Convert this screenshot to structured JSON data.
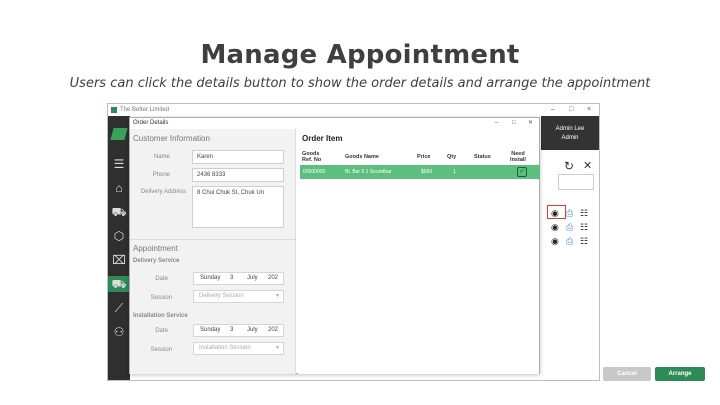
{
  "slide": {
    "title": "Manage Appointment",
    "subtitle": "Users can click the details button to show the order details and arrange the appointment"
  },
  "app": {
    "window_title": "The Better Limited",
    "user_name": "Admin Lee",
    "user_role": "Admin",
    "win_min": "–",
    "win_max": "□",
    "win_close": "×"
  },
  "dialog": {
    "title": "Order Details",
    "controls": {
      "min": "–",
      "max": "□",
      "close": "✕"
    },
    "customer": {
      "heading": "Customer Information",
      "name_label": "Name",
      "name_value": "Karen",
      "phone_label": "Phone",
      "phone_value": "2436 8333",
      "address_label": "Delivery Address",
      "address_value": "8 Chui Chuk St, Chuk Un"
    },
    "appointment": {
      "heading": "Appointment",
      "delivery_heading": "Delivery Service",
      "delivery_date_label": "Date",
      "delivery_date": {
        "weekday": "Sunday",
        "day": "3",
        "month": "July",
        "year": "202"
      },
      "delivery_session_label": "Session",
      "delivery_session_placeholder": "Delivery Session",
      "install_heading": "Installation Service",
      "install_date_label": "Date",
      "install_date": {
        "weekday": "Sunday",
        "day": "3",
        "month": "July",
        "year": "202"
      },
      "install_session_label": "Session",
      "install_session_placeholder": "Installation Session"
    },
    "order": {
      "heading": "Order Item",
      "columns": [
        "Goods Ref. No",
        "Goods Name",
        "Price",
        "Qty",
        "Status",
        "Need Install"
      ],
      "rows": [
        {
          "ref": "00000000",
          "name": "BL Bar 5.1 Soundbar",
          "price": "$560",
          "qty": "1",
          "status": "",
          "need_install": true
        }
      ]
    },
    "buttons": {
      "cancel": "Cancel",
      "arrange": "Arrange"
    }
  },
  "icons": {
    "sidebar": [
      "menu-icon",
      "home-icon",
      "cart-icon",
      "box-icon",
      "bag-icon",
      "truck-icon",
      "chart-icon",
      "users-icon"
    ],
    "row_actions": [
      "eye-icon",
      "printer-icon",
      "list-icon"
    ]
  },
  "colors": {
    "accent": "#2e8b57",
    "row_selected": "#5cbf7f",
    "highlight": "#e53935"
  }
}
